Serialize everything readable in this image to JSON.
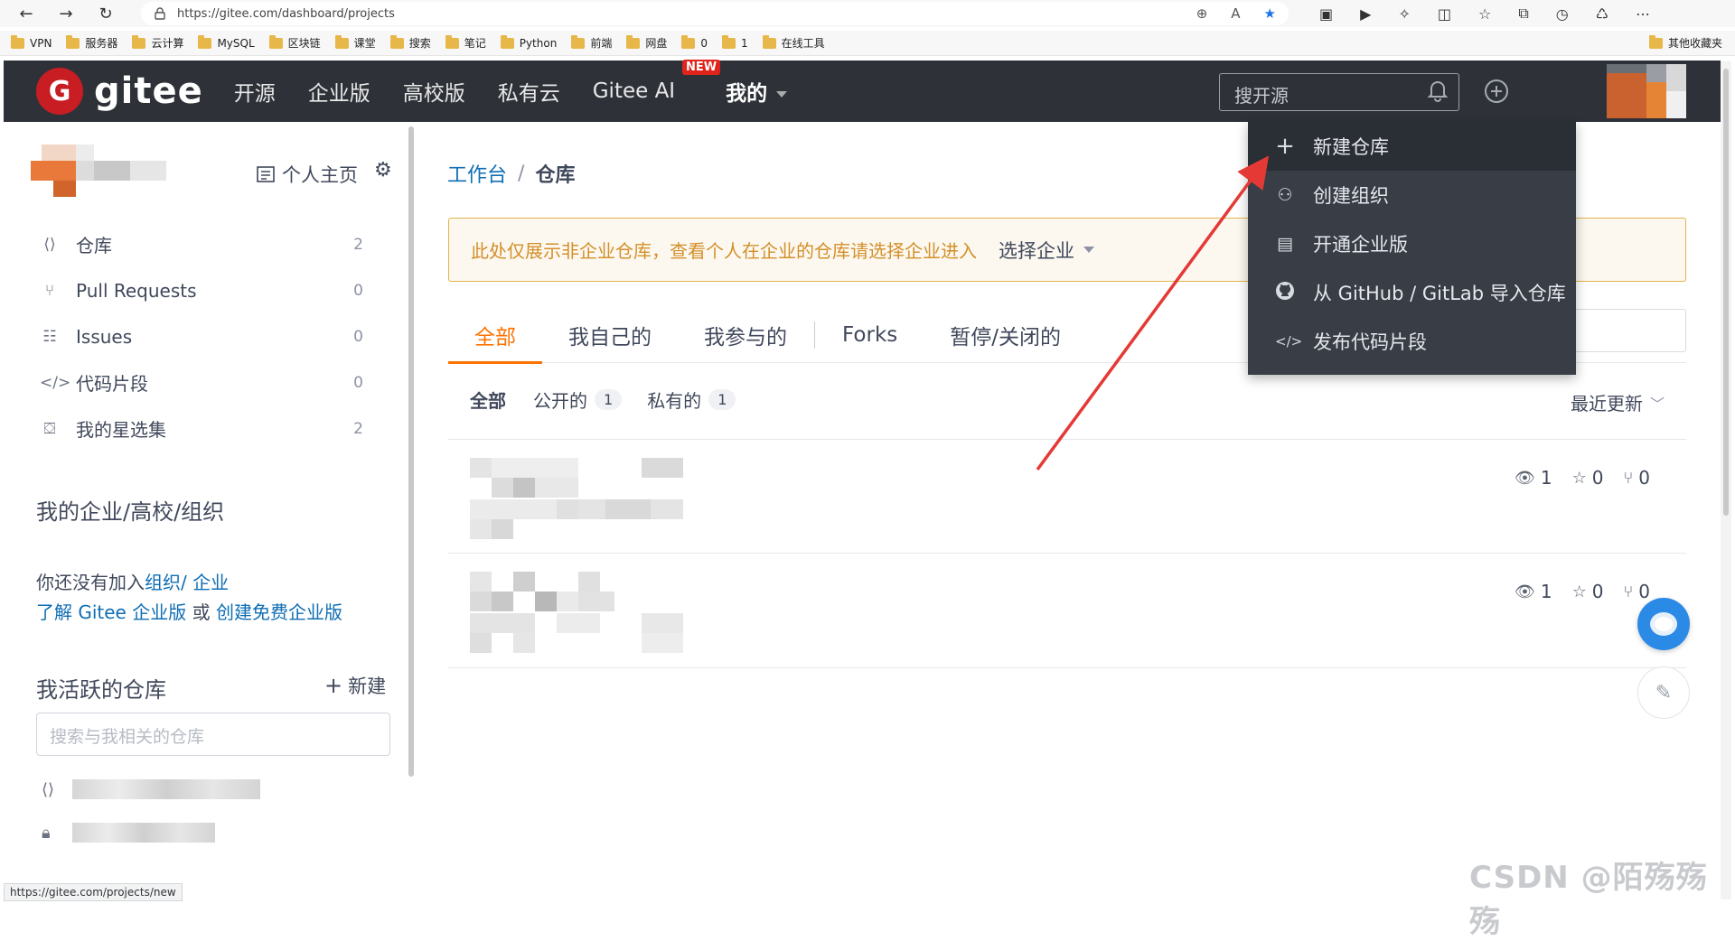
{
  "browser": {
    "url": "https://gitee.com/dashboard/projects",
    "bookmarks": [
      "VPN",
      "服务器",
      "云计算",
      "MySQL",
      "区块链",
      "课堂",
      "搜索",
      "笔记",
      "Python",
      "前端",
      "网盘",
      "0",
      "1",
      "在线工具"
    ],
    "other_bookmarks": "其他收藏夹",
    "status_url": "https://gitee.com/projects/new"
  },
  "header": {
    "logo_text": "gitee",
    "nav": [
      "开源",
      "企业版",
      "高校版",
      "私有云",
      "Gitee AI"
    ],
    "new_badge": "NEW",
    "mine": "我的",
    "search_placeholder": "搜开源"
  },
  "sidebar": {
    "homepage": "个人主页",
    "menu": [
      {
        "label": "仓库",
        "count": "2",
        "icon": "repo-icon"
      },
      {
        "label": "Pull Requests",
        "count": "0",
        "icon": "pull-request-icon"
      },
      {
        "label": "Issues",
        "count": "0",
        "icon": "issues-icon"
      },
      {
        "label": "代码片段",
        "count": "0",
        "icon": "code-icon"
      },
      {
        "label": "我的星选集",
        "count": "2",
        "icon": "star-collection-icon"
      }
    ],
    "org_title": "我的企业/高校/组织",
    "org_text": "你还没有加入",
    "org_link": "组织",
    "org_link2": "/ 企业",
    "learn_link": "了解 Gitee 企业版",
    "or_text": " 或 ",
    "create_link": "创建免费企业版",
    "active_title": "我活跃的仓库",
    "new_label": "新建",
    "repo_search_placeholder": "搜索与我相关的仓库"
  },
  "main": {
    "breadcrumb_link": "工作台",
    "breadcrumb_sep": "/",
    "breadcrumb_current": "仓库",
    "notice": "此处仅展示非企业仓库，查看个人在企业的仓库请选择企业进入",
    "notice_select": "选择企业",
    "tabs": [
      "全部",
      "我自己的",
      "我参与的",
      "Forks",
      "暂停/关闭的"
    ],
    "filters": {
      "all": "全部",
      "public": "公开的",
      "public_count": "1",
      "private": "私有的",
      "private_count": "1"
    },
    "sort": "最近更新",
    "repos": [
      {
        "watch": "1",
        "star": "0",
        "fork": "0"
      },
      {
        "watch": "1",
        "star": "0",
        "fork": "0"
      }
    ]
  },
  "dropdown": {
    "items": [
      {
        "label": "新建仓库",
        "icon": "plus-icon"
      },
      {
        "label": "创建组织",
        "icon": "group-icon"
      },
      {
        "label": "开通企业版",
        "icon": "building-icon"
      },
      {
        "label": "从 GitHub / GitLab 导入仓库",
        "icon": "github-icon"
      },
      {
        "label": "发布代码片段",
        "icon": "code-icon"
      }
    ]
  },
  "watermark": "CSDN @陌殇殇殇",
  "colors": {
    "header_bg": "#2e3238",
    "accent": "#fe7300",
    "link": "#0f6eb4",
    "annotation_arrow": "#e53935"
  }
}
